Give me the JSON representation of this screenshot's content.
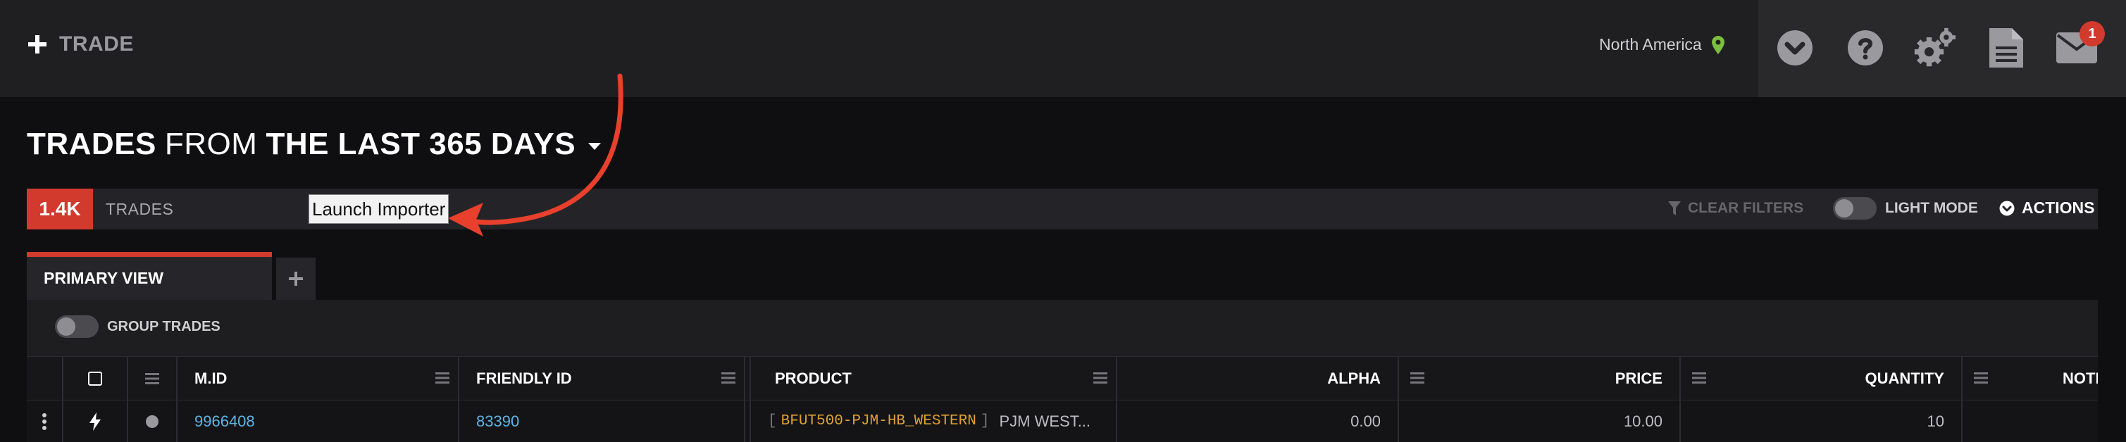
{
  "header": {
    "brand_label": "TRADE",
    "region": "North America",
    "notification_count": "1",
    "icons": [
      "chevron-down-circle-icon",
      "help-icon",
      "settings-icon",
      "document-icon",
      "mail-icon"
    ]
  },
  "title": {
    "part1": "TRADES",
    "part2": "FROM",
    "part3": "THE LAST 365 DAYS"
  },
  "summary": {
    "count": "1.4K",
    "label": "TRADES",
    "launch_importer": "Launch Importer",
    "clear_filters": "CLEAR FILTERS",
    "light_mode": "LIGHT MODE",
    "actions": "ACTIONS"
  },
  "tabs": {
    "primary": "PRIMARY VIEW"
  },
  "grid": {
    "group_trades": "GROUP TRADES",
    "columns": {
      "mid": "M.ID",
      "friendly_id": "FRIENDLY ID",
      "product": "PRODUCT",
      "alpha": "ALPHA",
      "price": "PRICE",
      "quantity": "QUANTITY",
      "notional": "NOTI"
    },
    "rows": [
      {
        "mid": "9966408",
        "friendly_id": "83390",
        "product_code": "BFUT500-PJM-HB_WESTERN",
        "product_name": "PJM WEST...",
        "alpha": "0.00",
        "price": "10.00",
        "quantity": "10"
      }
    ]
  },
  "colors": {
    "accent": "#d23a2e",
    "link": "#5eb5e6",
    "product_code": "#e0a030",
    "region_pin": "#7bbf3f"
  }
}
